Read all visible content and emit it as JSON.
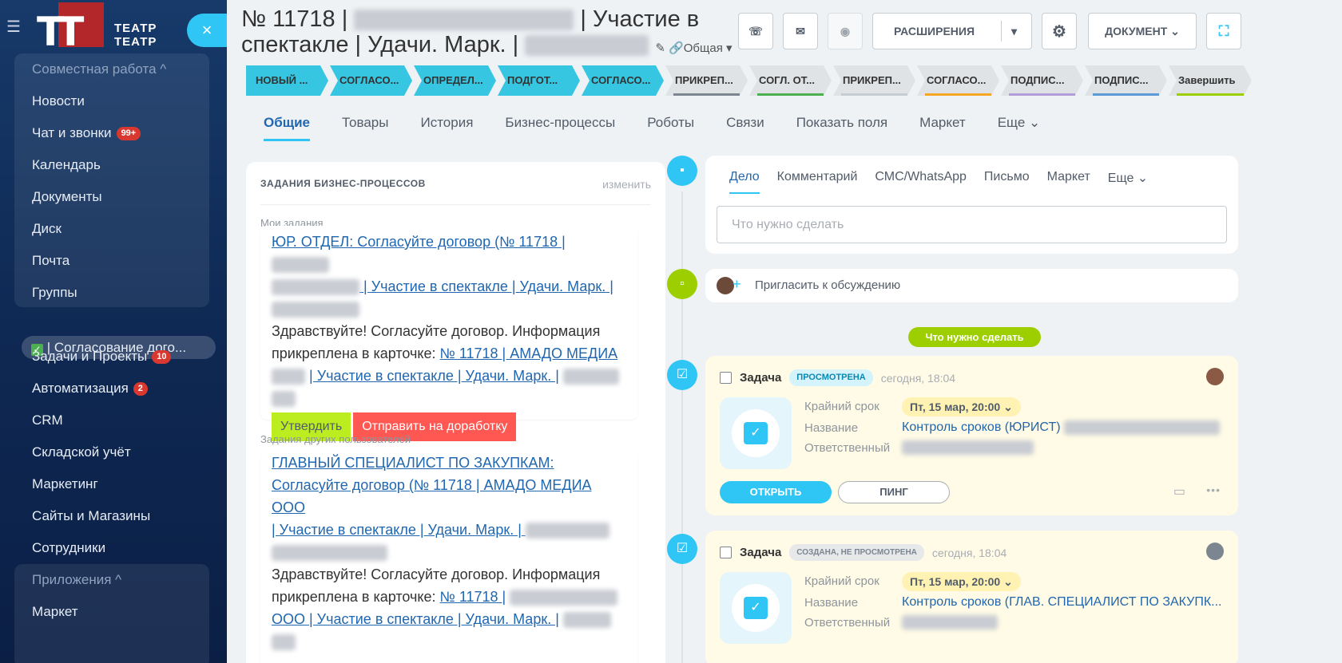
{
  "sidebar": {
    "logo_text_1": "ТЕАТР",
    "logo_text_2": "ТЕАТР",
    "close": "×",
    "group1_title": "Совместная работа ^",
    "items1": [
      "Новости",
      "Чат и звонки",
      "Календарь",
      "Документы",
      "Диск",
      "Почта",
      "Группы"
    ],
    "chat_badge": "99+",
    "active_item": "| Согласование дого...",
    "active_check": "✓",
    "items2": [
      "Задачи и Проекты",
      "Автоматизация",
      "CRM",
      "Складской учёт",
      "Маркетинг",
      "Сайты и Магазины",
      "Сотрудники"
    ],
    "tasks_badge": "10",
    "auto_badge": "2",
    "group2_title": "Приложения ^",
    "group2_item": "Маркет"
  },
  "header": {
    "title_part1": "№ 11718 |",
    "title_part2": "| Участие в",
    "title_line2": "спектакле | Удачи. Марк. |",
    "title_tag": "✎ 🔗Общая ▾",
    "extensions": "РАСШИРЕНИЯ",
    "document": "ДОКУМЕНТ ⌄",
    "phone_icon": "☏",
    "mail_icon": "✉",
    "globe_icon": "◉",
    "caret": "▾",
    "gear_icon": "⚙",
    "expand_icon": "⛶"
  },
  "stages": [
    {
      "label": "НОВЫЙ ...",
      "on": true,
      "color": ""
    },
    {
      "label": "СОГЛАСО...",
      "on": true,
      "color": ""
    },
    {
      "label": "ОПРЕДЕЛ...",
      "on": true,
      "color": ""
    },
    {
      "label": "ПОДГОТ...",
      "on": true,
      "color": ""
    },
    {
      "label": "СОГЛАСО...",
      "on": true,
      "color": ""
    },
    {
      "label": "ПРИКРЕП...",
      "on": false,
      "color": "#7b8691"
    },
    {
      "label": "СОГЛ. ОТ...",
      "on": false,
      "color": "#4caf50"
    },
    {
      "label": "ПРИКРЕП...",
      "on": false,
      "color": "#c6cdd3"
    },
    {
      "label": "СОГЛАСО...",
      "on": false,
      "color": "#f5a623"
    },
    {
      "label": "ПОДПИС...",
      "on": false,
      "color": "#b39ddb"
    },
    {
      "label": "ПОДПИС...",
      "on": false,
      "color": "#5c9bd6"
    },
    {
      "label": "Завершить",
      "on": false,
      "color": "#9dcf00"
    }
  ],
  "tabs": [
    "Общие",
    "Товары",
    "История",
    "Бизнес-процессы",
    "Роботы",
    "Связи",
    "Показать поля",
    "Маркет",
    "Еще ⌄"
  ],
  "bp": {
    "heading": "ЗАДАНИЯ БИЗНЕС-ПРОЦЕССОВ",
    "edit": "изменить",
    "my_tasks": "Мои задания",
    "t1_link_a": "ЮР. ОТДЕЛ: Согласуйте договор (№ 11718 |",
    "t1_link_b": "| Участие в спектакле | Удачи. Марк. |",
    "t1_text_a": "Здравствуйте! Согласуйте договор. Информация",
    "t1_text_b": "прикреплена в карточке:",
    "t1_link_c": "№ 11718 | АМАДО МЕДИА",
    "t1_link_d": "| Участие в спектакле | Удачи. Марк. |",
    "approve": "Утвердить",
    "reject": "Отправить на доработку",
    "others": "Задания других пользователей",
    "t2_link_a": "ГЛАВНЫЙ СПЕЦИАЛИСТ ПО ЗАКУПКАМ:",
    "t2_link_b": "Согласуйте договор (№ 11718 | АМАДО МЕДИА ООО",
    "t2_link_c": "| Участие в спектакле | Удачи. Марк. |",
    "t2_text_a": "Здравствуйте! Согласуйте договор. Информация",
    "t2_text_b": "прикреплена в карточке:",
    "t2_link_d": "№ 11718 |",
    "t2_link_e": "ООО | Участие в спектакле | Удачи. Марк. |"
  },
  "activity": {
    "tabs": [
      "Дело",
      "Комментарий",
      "СМС/WhatsApp",
      "Письмо",
      "Маркет",
      "Еще ⌄"
    ],
    "placeholder": "Что нужно сделать",
    "invite": "Пригласить к обсуждению",
    "plus": "+",
    "todo_pill": "Что нужно сделать"
  },
  "tasks": [
    {
      "title": "Задача",
      "status": "ПРОСМОТРЕНА",
      "time": "сегодня, 18:04",
      "deadline_label": "Крайний срок",
      "deadline": "Пт, 15 мар, 20:00 ⌄",
      "name_label": "Название",
      "name": "Контроль сроков (ЮРИСТ)",
      "resp_label": "Ответственный",
      "open": "ОТКРЫТЬ",
      "ping": "ПИНГ",
      "more": "•••"
    },
    {
      "title": "Задача",
      "status": "СОЗДАНА, НЕ ПРОСМОТРЕНА",
      "time": "сегодня, 18:04",
      "deadline_label": "Крайний срок",
      "deadline": "Пт, 15 мар, 20:00 ⌄",
      "name_label": "Название",
      "name": "Контроль сроков (ГЛАВ. СПЕЦИАЛИСТ ПО ЗАКУПК...",
      "resp_label": "Ответственный"
    }
  ],
  "colors": {
    "accent": "#2fc6f6",
    "link": "#2067b0",
    "approve": "#bbed21",
    "reject": "#ff5752"
  }
}
